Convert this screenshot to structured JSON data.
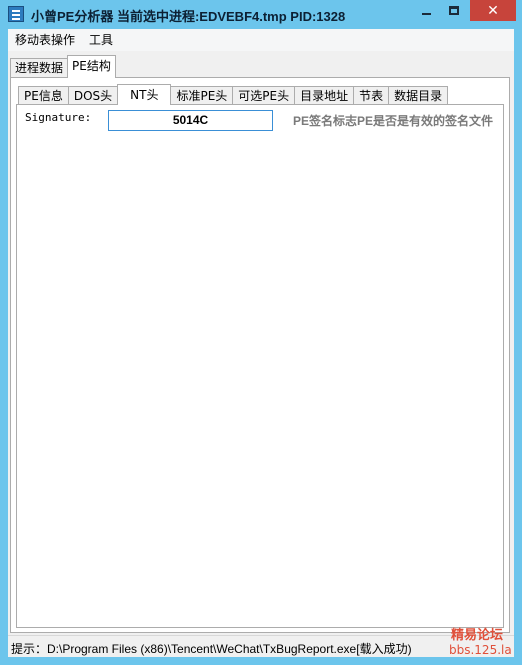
{
  "window": {
    "title": "小曾PE分析器 当前选中进程:EDVEBF4.tmp PID:1328",
    "icon": "app-icon",
    "controls": {
      "minimize": "minimize-icon",
      "maximize": "maximize-icon",
      "close": "✕"
    },
    "titlebar_color": "#6cc5ec",
    "close_color": "#c7443b"
  },
  "menubar": {
    "items": [
      {
        "label": "移动表操作"
      },
      {
        "label": "工具"
      }
    ]
  },
  "outer_tabs": [
    {
      "label": "进程数据",
      "active": false
    },
    {
      "label": "PE结构",
      "active": true
    }
  ],
  "inner_tabs": [
    {
      "label": "PE信息",
      "active": false
    },
    {
      "label": "DOS头",
      "active": false
    },
    {
      "label": "NT头",
      "active": true
    },
    {
      "label": "标准PE头",
      "active": false
    },
    {
      "label": "可选PE头",
      "active": false
    },
    {
      "label": "目录地址",
      "active": false
    },
    {
      "label": "节表",
      "active": false
    },
    {
      "label": "数据目录",
      "active": false
    }
  ],
  "nt_header": {
    "signature_label": "Signature:",
    "signature_value": "5014C",
    "signature_desc": "PE签名标志PE是否是有效的签名文件"
  },
  "statusbar": {
    "text": "提示：D:\\Program Files (x86)\\Tencent\\WeChat\\TxBugReport.exe[载入成功)"
  },
  "watermark": {
    "line1": "精易论坛",
    "line2": "bbs.125.la",
    "color": "#e0503a"
  }
}
